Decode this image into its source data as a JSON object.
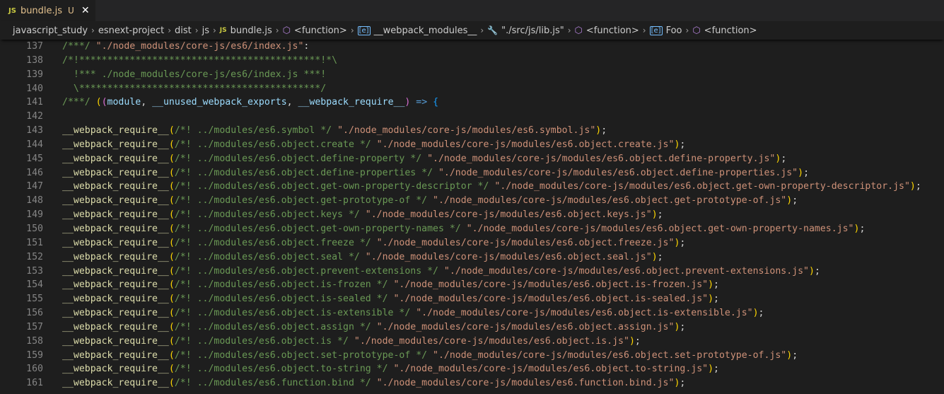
{
  "tab": {
    "badge": "JS",
    "filename": "bundle.js",
    "status": "U",
    "close": "✕"
  },
  "breadcrumbs": [
    {
      "label": "javascript_study",
      "icon": ""
    },
    {
      "label": "esnext-project",
      "icon": ""
    },
    {
      "label": "dist",
      "icon": ""
    },
    {
      "label": "js",
      "icon": ""
    },
    {
      "label": "bundle.js",
      "icon": "js-file-icon",
      "icon_text": "JS"
    },
    {
      "label": "<function>",
      "icon": "cube-icon",
      "icon_text": "⬡"
    },
    {
      "label": "__webpack_modules__",
      "icon": "module-icon",
      "icon_text": "[e]"
    },
    {
      "label": "\"./src/js/lib.js\"",
      "icon": "wrench-icon",
      "icon_text": "🔧"
    },
    {
      "label": "<function>",
      "icon": "cube-icon",
      "icon_text": "⬡"
    },
    {
      "label": "Foo",
      "icon": "module-icon",
      "icon_text": "[e]"
    },
    {
      "label": "<function>",
      "icon": "cube-icon",
      "icon_text": "⬡"
    }
  ],
  "separator": "›",
  "editor": {
    "header_lines": [
      {
        "num": "137",
        "text": "/***/ \"./node_modules/core-js/es6/index.js\":"
      },
      {
        "num": "138",
        "text": "/*!*******************************************!*\\"
      },
      {
        "num": "139",
        "text": "  !*** ./node_modules/core-js/es6/index.js ***!"
      },
      {
        "num": "140",
        "text": "  \\*******************************************/"
      },
      {
        "num": "141",
        "prefix": "/***/ ",
        "params": "module, __unused_webpack_exports, __webpack_require__",
        "arrow": " => {"
      },
      {
        "num": "142",
        "text": ""
      }
    ],
    "require_fn": "__webpack_require__",
    "require_lines": [
      {
        "num": "143",
        "comment": "/*! ../modules/es6.symbol */",
        "path": "\"./node_modules/core-js/modules/es6.symbol.js\""
      },
      {
        "num": "144",
        "comment": "/*! ../modules/es6.object.create */",
        "path": "\"./node_modules/core-js/modules/es6.object.create.js\""
      },
      {
        "num": "145",
        "comment": "/*! ../modules/es6.object.define-property */",
        "path": "\"./node_modules/core-js/modules/es6.object.define-property.js\""
      },
      {
        "num": "146",
        "comment": "/*! ../modules/es6.object.define-properties */",
        "path": "\"./node_modules/core-js/modules/es6.object.define-properties.js\""
      },
      {
        "num": "147",
        "comment": "/*! ../modules/es6.object.get-own-property-descriptor */",
        "path": "\"./node_modules/core-js/modules/es6.object.get-own-property-descriptor.js\""
      },
      {
        "num": "148",
        "comment": "/*! ../modules/es6.object.get-prototype-of */",
        "path": "\"./node_modules/core-js/modules/es6.object.get-prototype-of.js\""
      },
      {
        "num": "149",
        "comment": "/*! ../modules/es6.object.keys */",
        "path": "\"./node_modules/core-js/modules/es6.object.keys.js\""
      },
      {
        "num": "150",
        "comment": "/*! ../modules/es6.object.get-own-property-names */",
        "path": "\"./node_modules/core-js/modules/es6.object.get-own-property-names.js\""
      },
      {
        "num": "151",
        "comment": "/*! ../modules/es6.object.freeze */",
        "path": "\"./node_modules/core-js/modules/es6.object.freeze.js\""
      },
      {
        "num": "152",
        "comment": "/*! ../modules/es6.object.seal */",
        "path": "\"./node_modules/core-js/modules/es6.object.seal.js\""
      },
      {
        "num": "153",
        "comment": "/*! ../modules/es6.object.prevent-extensions */",
        "path": "\"./node_modules/core-js/modules/es6.object.prevent-extensions.js\""
      },
      {
        "num": "154",
        "comment": "/*! ../modules/es6.object.is-frozen */",
        "path": "\"./node_modules/core-js/modules/es6.object.is-frozen.js\""
      },
      {
        "num": "155",
        "comment": "/*! ../modules/es6.object.is-sealed */",
        "path": "\"./node_modules/core-js/modules/es6.object.is-sealed.js\""
      },
      {
        "num": "156",
        "comment": "/*! ../modules/es6.object.is-extensible */",
        "path": "\"./node_modules/core-js/modules/es6.object.is-extensible.js\""
      },
      {
        "num": "157",
        "comment": "/*! ../modules/es6.object.assign */",
        "path": "\"./node_modules/core-js/modules/es6.object.assign.js\""
      },
      {
        "num": "158",
        "comment": "/*! ../modules/es6.object.is */",
        "path": "\"./node_modules/core-js/modules/es6.object.is.js\""
      },
      {
        "num": "159",
        "comment": "/*! ../modules/es6.object.set-prototype-of */",
        "path": "\"./node_modules/core-js/modules/es6.object.set-prototype-of.js\""
      },
      {
        "num": "160",
        "comment": "/*! ../modules/es6.object.to-string */",
        "path": "\"./node_modules/core-js/modules/es6.object.to-string.js\""
      },
      {
        "num": "161",
        "comment": "/*! ../modules/es6.function.bind */",
        "path": "\"./node_modules/core-js/modules/es6.function.bind.js\""
      }
    ]
  }
}
